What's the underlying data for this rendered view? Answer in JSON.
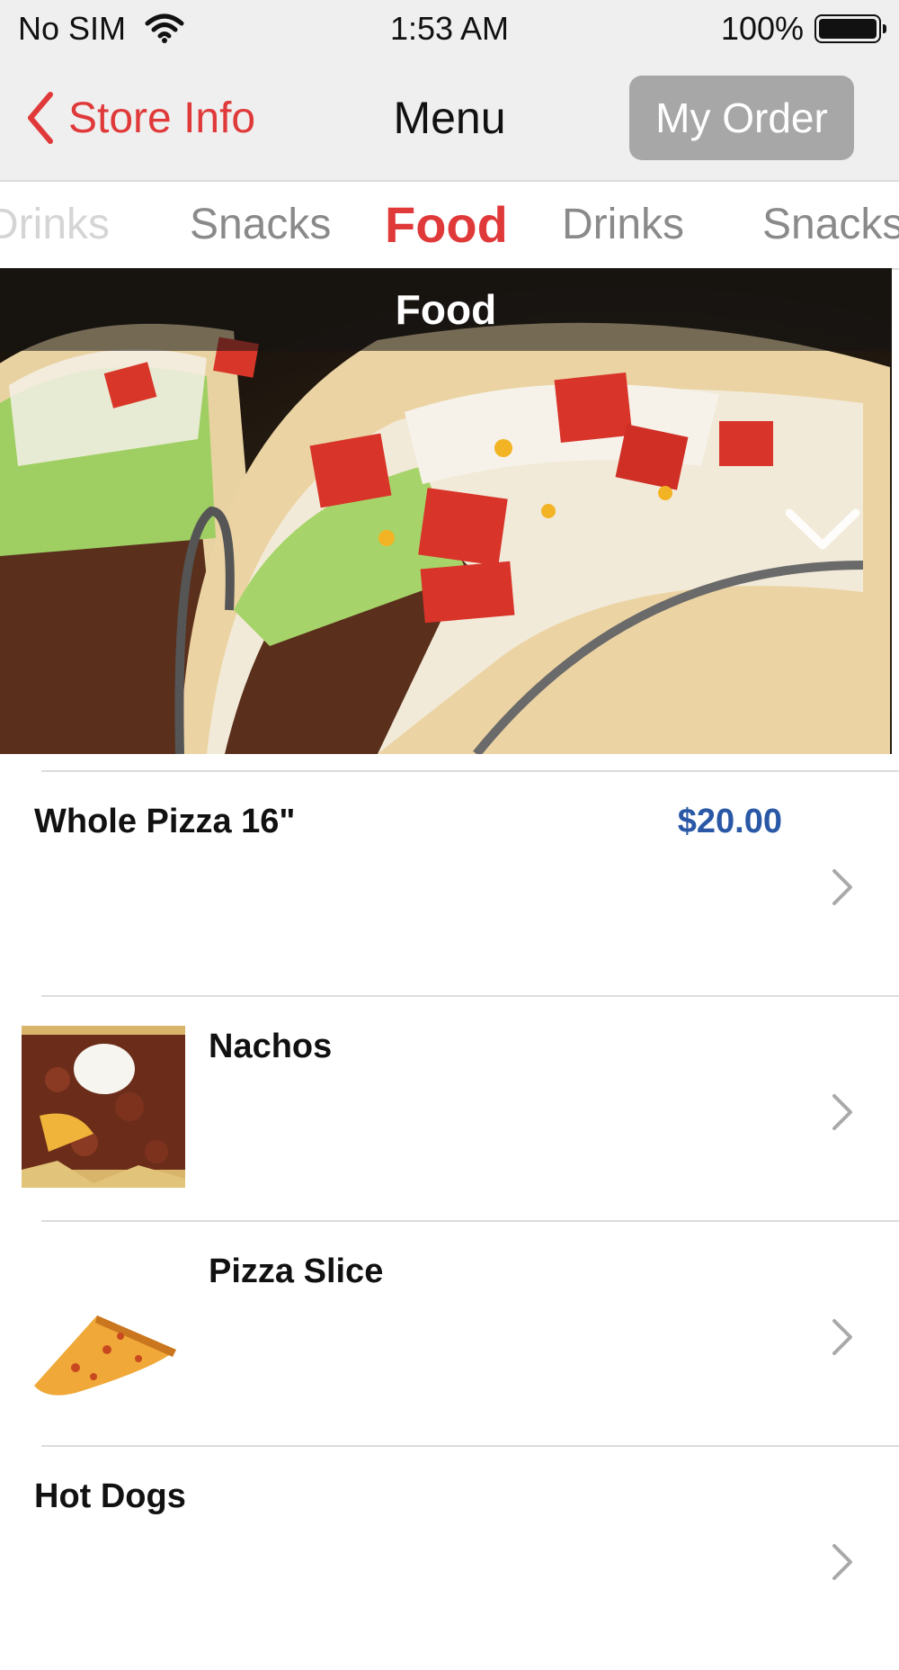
{
  "status_bar": {
    "carrier": "No SIM",
    "time": "1:53 AM",
    "battery": "100%"
  },
  "nav": {
    "back_label": "Store Info",
    "title": "Menu",
    "order_button": "My Order"
  },
  "tabs": [
    {
      "label": "Drinks",
      "state": "faded"
    },
    {
      "label": "Snacks",
      "state": "normal"
    },
    {
      "label": "Food",
      "state": "active"
    },
    {
      "label": "Drinks",
      "state": "normal"
    },
    {
      "label": "Snacks",
      "state": "normal"
    }
  ],
  "hero": {
    "title": "Food"
  },
  "items": [
    {
      "name": "Whole Pizza 16\"",
      "price": "$20.00",
      "image": "none"
    },
    {
      "name": "Nachos",
      "price": "",
      "image": "nachos-photo"
    },
    {
      "name": "Pizza Slice",
      "price": "",
      "image": "pizza-slice-photo"
    },
    {
      "name": "Hot Dogs",
      "price": "",
      "image": "none"
    }
  ],
  "colors": {
    "accent": "#e0393a",
    "price": "#2a58a6",
    "nav_bg": "#efefef",
    "order_button_bg": "#a7a7a7"
  }
}
